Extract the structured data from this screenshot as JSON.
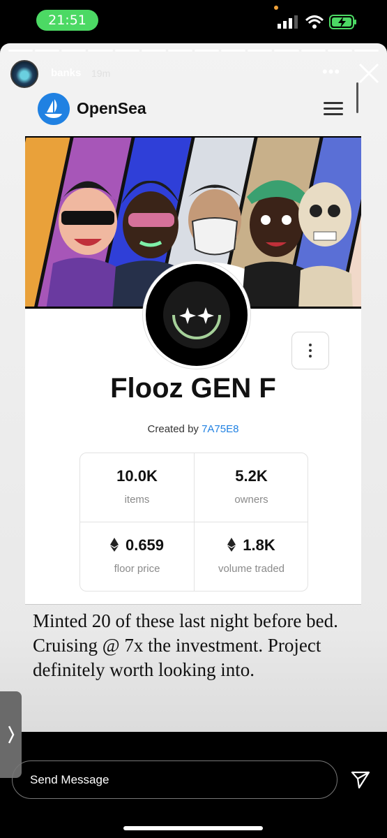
{
  "status_bar": {
    "time": "21:51"
  },
  "story": {
    "username": "banks",
    "time_ago": "19m",
    "progress_segments": 14
  },
  "opensea": {
    "brand": "OpenSea"
  },
  "collection": {
    "name": "Flooz GEN F",
    "created_by_prefix": "Created by ",
    "creator": "7A75E8",
    "stats": [
      {
        "value": "10.0K",
        "label": "items",
        "eth": false
      },
      {
        "value": "5.2K",
        "label": "owners",
        "eth": false
      },
      {
        "value": "0.659",
        "label": "floor price",
        "eth": true
      },
      {
        "value": "1.8K",
        "label": "volume traded",
        "eth": true
      }
    ]
  },
  "caption": "Minted 20 of these last night before bed. Cruising @ 7x the investment. Project definitely worth looking into.",
  "message_bar": {
    "placeholder": "Send Message"
  },
  "colors": {
    "opensea_blue": "#2081e2",
    "status_green": "#4cd964"
  }
}
